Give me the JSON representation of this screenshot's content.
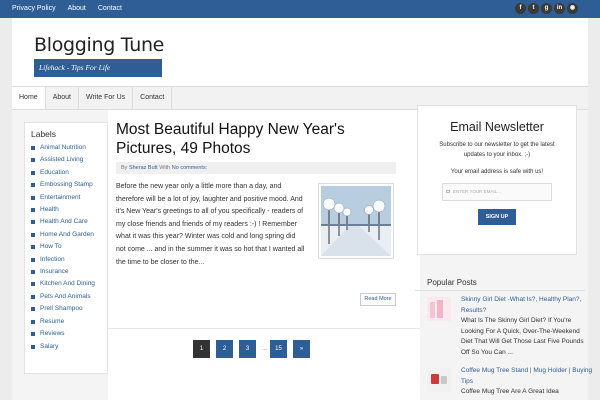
{
  "topbar": {
    "links": [
      "Privacy Policy",
      "About",
      "Contact"
    ],
    "social": [
      "f",
      "t",
      "g",
      "in",
      "rss"
    ]
  },
  "header": {
    "title": "Blogging Tune",
    "tagline": "Lifehack - Tips For Life"
  },
  "nav": [
    "Home",
    "About",
    "Write For Us",
    "Contact"
  ],
  "labels": {
    "title": "Labels",
    "items": [
      "Animal Nutrition",
      "Assisted Living",
      "Education",
      "Embossing Stamp",
      "Entertainment",
      "Health",
      "Health And Care",
      "Home And Garden",
      "How To",
      "Infection",
      "Insurance",
      "Kitchen And Dining",
      "Pets And Animals",
      "Prell Shampoo",
      "Resume",
      "Reviews",
      "Salary"
    ]
  },
  "post": {
    "title": "Most Beautiful Happy New Year's Pictures, 49 Photos",
    "meta_by": "By",
    "author": "Sheraz Butt",
    "meta_with": "With",
    "comments": "No comments:",
    "body": "Before the new year only a little more than a day, and therefore will be a lot of joy, laughter and positive mood. And it's New Year's greetings to all of you specifically - readers of my close friends and friends of my readers :-) ! Remember what it was this year? Winter was cold    and long spring did not come ...    and in the summer it was so hot that I wanted all the time to be closer to the...",
    "read_more": "Read More"
  },
  "pager": {
    "pages": [
      "1",
      "2",
      "3",
      "15",
      "»"
    ],
    "ellipsis": "..."
  },
  "newsletter": {
    "title": "Email Newsletter",
    "subtitle": "Subscribe to our newsletter to get the latest updates to your inbox. ;-)",
    "safe": "Your email address is safe with us!",
    "placeholder": "ENTER YOUR EMAIL...",
    "button": "SIGN UP"
  },
  "popular": {
    "title": "Popular Posts",
    "items": [
      {
        "title": "Skinny Girl Diet -What Is?, Healthy Plan?, Results?",
        "excerpt": "What Is The Skinny Girl Diet? If You're Looking For A Quick, Over-The-Weekend Diet That Will Get Those Last Five Pounds Off So You Can ..."
      },
      {
        "title": "Coffee Mug Tree Stand | Mug Holder | Buying Tips",
        "excerpt": "Coffee Mug Tree Are A Great Idea"
      }
    ]
  },
  "colors": {
    "accent": "#2e5e95",
    "background": "#ececec"
  }
}
